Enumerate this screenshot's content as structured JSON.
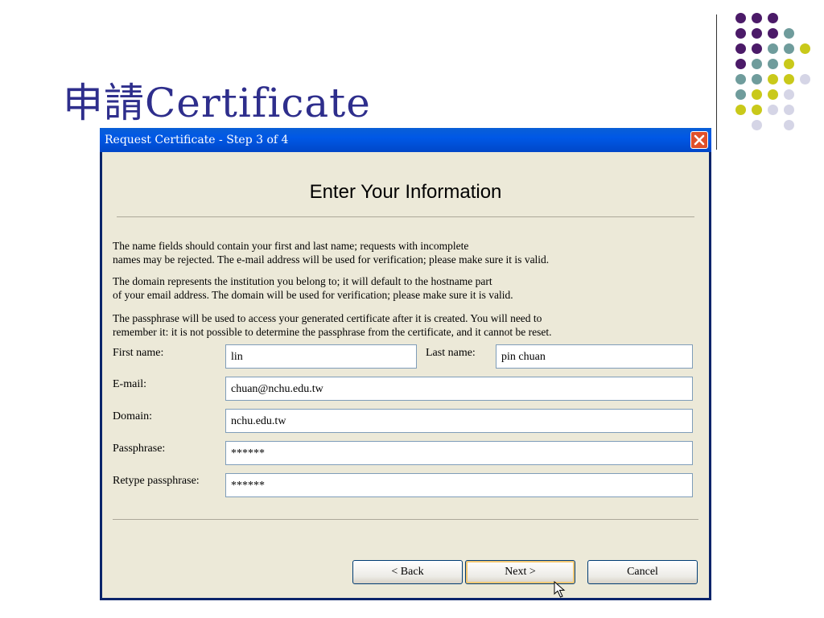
{
  "slide": {
    "title": "申請Certificate"
  },
  "window": {
    "title": "Request Certificate - Step 3 of 4",
    "heading": "Enter Your Information",
    "paragraphs": [
      [
        "The name fields should contain your first and last name; requests with incomplete",
        "names may be rejected. The e-mail address will be used for verification; please make sure it is valid."
      ],
      [
        "The domain represents the institution you belong to; it will default to the hostname part",
        "of your email address.  The domain will be used for verification; please make sure it is valid."
      ],
      [
        "The passphrase will be used to access your generated certificate after it is created.  You will need to",
        "remember it: it is not possible to determine the passphrase from the certificate, and it cannot be reset."
      ]
    ],
    "form": {
      "first_name_label": "First name:",
      "first_name_value": "lin",
      "last_name_label": "Last name:",
      "last_name_value": "pin chuan",
      "email_label": "E-mail:",
      "email_value": "chuan@nchu.edu.tw",
      "domain_label": "Domain:",
      "domain_value": "nchu.edu.tw",
      "passphrase_label": "Passphrase:",
      "passphrase_value": "******",
      "retype_label": "Retype passphrase:",
      "retype_value": "******"
    },
    "buttons": {
      "back": "< Back",
      "next": "Next >",
      "cancel": "Cancel"
    }
  },
  "colors": {
    "title_text": "#2e2e8c",
    "dot_purple": "#4b1a68",
    "dot_teal": "#6f9c9c",
    "dot_yellow": "#c9c91a",
    "dot_lavender": "#d5d5e6"
  }
}
